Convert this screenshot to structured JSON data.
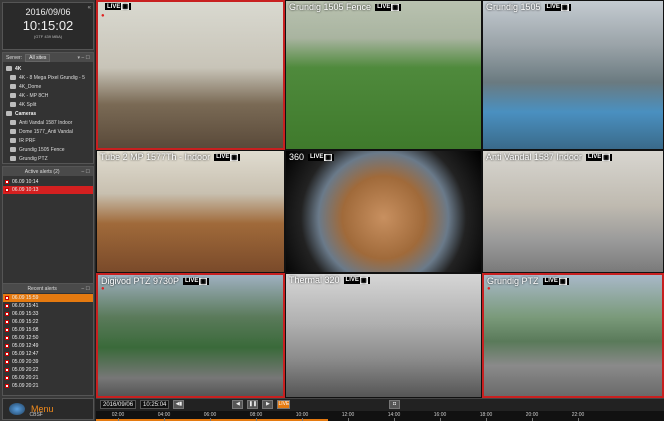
{
  "clock": {
    "date": "2016/09/06",
    "time": "10:15:02",
    "sub": "(GTF 439 MBA)"
  },
  "servers_panel": {
    "label": "Server:",
    "selected": "All sites",
    "items": [
      {
        "label": "4K",
        "type": "group"
      },
      {
        "label": "4K - 8 Mega Pixel Grundig - 5",
        "type": "sub"
      },
      {
        "label": "4K_Dome",
        "type": "sub"
      },
      {
        "label": "4K - MP 8CH",
        "type": "sub"
      },
      {
        "label": "4K Split",
        "type": "sub"
      },
      {
        "label": "Cameras",
        "type": "group"
      },
      {
        "label": "Anti Vandal 1587 Indoor",
        "type": "sub"
      },
      {
        "label": "Dome 1577_Anti Vandal",
        "type": "sub"
      },
      {
        "label": "IR PRF",
        "type": "sub"
      },
      {
        "label": "Grundig 1505 Fence",
        "type": "sub"
      },
      {
        "label": "Grundig PTZ",
        "type": "sub"
      }
    ]
  },
  "active_alerts": {
    "title": "Active alerts (2)",
    "items": [
      {
        "time": "06.09 10:14",
        "text": "",
        "style": "plain"
      },
      {
        "time": "06.09 10:13",
        "text": "",
        "style": "red"
      }
    ]
  },
  "recent_alerts": {
    "title": "Recent alerts",
    "items": [
      {
        "time": "06.09 15:59",
        "style": "orange"
      },
      {
        "time": "06.09 15:41",
        "style": "plain"
      },
      {
        "time": "06.09 15:33",
        "style": "plain"
      },
      {
        "time": "06.09 15:22",
        "style": "plain"
      },
      {
        "time": "05.09 15:08",
        "style": "plain"
      },
      {
        "time": "05.09 12:50",
        "style": "plain"
      },
      {
        "time": "05.09 12:49",
        "style": "plain"
      },
      {
        "time": "05.09 12:47",
        "style": "plain"
      },
      {
        "time": "05.09 20:39",
        "style": "plain"
      },
      {
        "time": "05.09 20:22",
        "style": "plain"
      },
      {
        "time": "05.09 20:21",
        "style": "plain"
      },
      {
        "time": "05.09 20:21",
        "style": "plain"
      }
    ]
  },
  "menu": {
    "label": "Menu",
    "sub": "CBSF"
  },
  "tiles": [
    {
      "label": "",
      "selected": true,
      "theme": "office"
    },
    {
      "label": "Grundig 1505 Fence",
      "selected": false,
      "theme": "playground"
    },
    {
      "label": "Grundig 1505",
      "selected": false,
      "theme": "parking"
    },
    {
      "label": "Tube 2 MP 1577Th - Indoor",
      "selected": false,
      "theme": "office2"
    },
    {
      "label": "360",
      "selected": false,
      "theme": "fisheye"
    },
    {
      "label": "Anti Vandal 1587 Indoor",
      "selected": false,
      "theme": "corridor"
    },
    {
      "label": "Digivod PTZ 9730P",
      "selected": true,
      "theme": "street"
    },
    {
      "label": "Thermal 320",
      "selected": false,
      "theme": "thermal"
    },
    {
      "label": "Grundig PTZ",
      "selected": true,
      "theme": "aerial"
    }
  ],
  "live_badge": "LIVE",
  "timeline": {
    "date": "2016/09/06",
    "time": "10:25:04",
    "live_label": "LIVE",
    "ticks": [
      "02:00",
      "04:00",
      "06:00",
      "08:00",
      "10:00",
      "12:00",
      "14:00",
      "16:00",
      "18:00",
      "20:00",
      "22:00"
    ]
  }
}
